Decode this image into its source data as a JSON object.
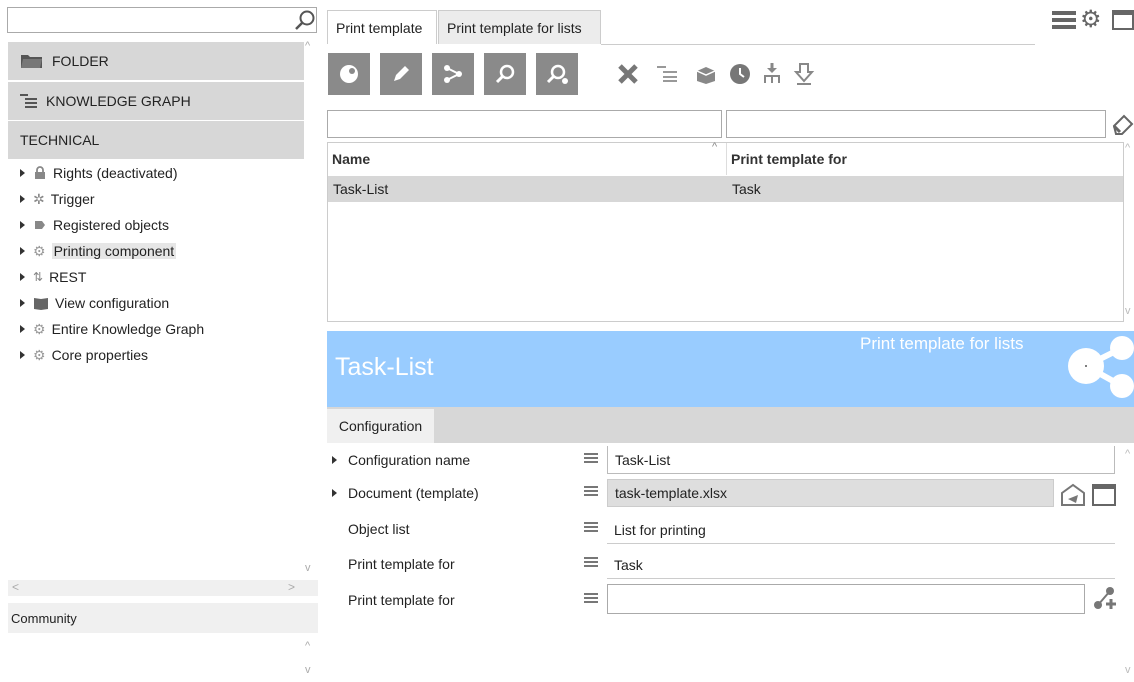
{
  "sidebar": {
    "search_placeholder": "",
    "sections": [
      {
        "label": "FOLDER",
        "icon": "folder-icon"
      },
      {
        "label": "KNOWLEDGE GRAPH",
        "icon": "tree-list-icon"
      },
      {
        "label": "TECHNICAL",
        "icon": ""
      }
    ],
    "tree": [
      {
        "label": "Rights (deactivated)",
        "icon": "lock-icon"
      },
      {
        "label": "Trigger",
        "icon": "trigger-icon"
      },
      {
        "label": "Registered objects",
        "icon": "pin-icon"
      },
      {
        "label": "Printing component",
        "icon": "gear-icon"
      },
      {
        "label": "REST",
        "icon": "transfer-icon"
      },
      {
        "label": "View configuration",
        "icon": "book-icon"
      },
      {
        "label": "Entire Knowledge Graph",
        "icon": "gear-icon"
      },
      {
        "label": "Core properties",
        "icon": "gear-icon"
      }
    ],
    "community_label": "Community"
  },
  "tabs": [
    {
      "label": "Print template"
    },
    {
      "label": "Print template for lists"
    }
  ],
  "grid": {
    "columns": [
      "Name",
      "Print template for"
    ],
    "rows": [
      {
        "name": "Task-List",
        "print_template_for": "Task"
      }
    ]
  },
  "detail": {
    "title": "Task-List",
    "type_label": "Print template for lists",
    "tab": "Configuration",
    "properties": [
      {
        "label": "Configuration name",
        "value": "Task-List"
      },
      {
        "label": "Document (template)",
        "value": "task-template.xlsx"
      },
      {
        "label": "Object list",
        "value": "List for printing"
      },
      {
        "label": "Print template for",
        "value": "Task"
      },
      {
        "label": "Print template for",
        "value": ""
      }
    ]
  },
  "colors": {
    "banner": "#99ccff",
    "toolbar_button": "#8a8a8a",
    "section_bg": "#d7d7d7"
  }
}
